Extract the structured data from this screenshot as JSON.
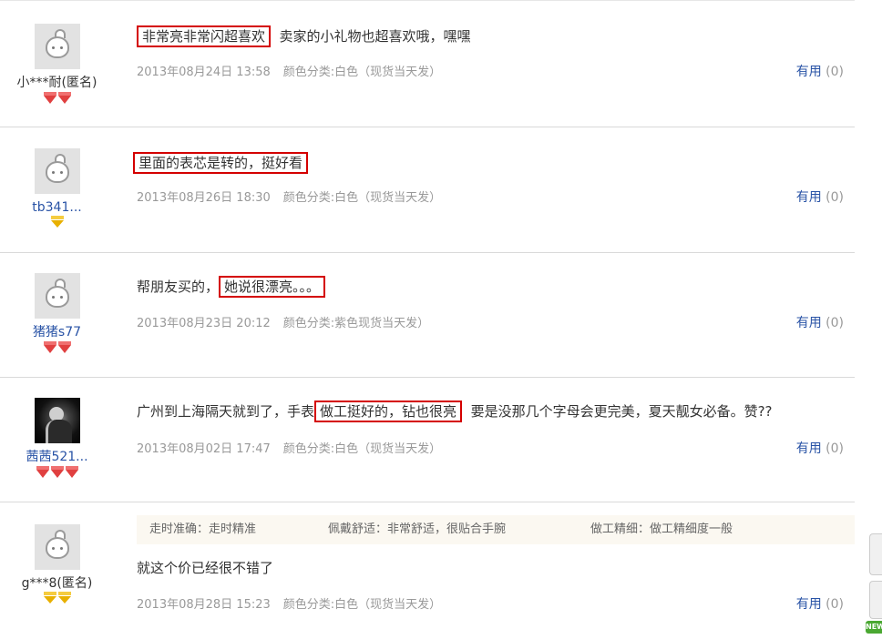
{
  "reviews": [
    {
      "user": {
        "name": "小***耐(匿名)",
        "link": false,
        "avatar": "default-avatar",
        "badge": {
          "color": "red",
          "count": 2
        }
      },
      "text_parts": [
        {
          "t": "非常亮非常闪超喜欢",
          "hl": true
        },
        {
          "t": "  卖家的小礼物也超喜欢哦，嘿嘿",
          "hl": false
        }
      ],
      "date": "2013年08月24日 13:58",
      "sku": "颜色分类:白色（现货当天发）",
      "useful_label": "有用",
      "useful_count": "(0)"
    },
    {
      "user": {
        "name": "tb341...",
        "link": true,
        "avatar": "default-avatar",
        "badge": {
          "color": "gold",
          "count": 1
        }
      },
      "text_parts": [
        {
          "t": "里面的表芯是转的，挺好看",
          "hl": true
        }
      ],
      "date": "2013年08月26日 18:30",
      "sku": "颜色分类:白色（现货当天发）",
      "useful_label": "有用",
      "useful_count": "(0)"
    },
    {
      "user": {
        "name": "猪猪s77",
        "link": true,
        "avatar": "default-avatar",
        "badge": {
          "color": "red",
          "count": 2
        }
      },
      "text_parts": [
        {
          "t": "帮朋友买的，",
          "hl": false
        },
        {
          "t": "她说很漂亮。。。",
          "hl": true
        }
      ],
      "date": "2013年08月23日 20:12",
      "sku": "颜色分类:紫色现货当天发）",
      "useful_label": "有用",
      "useful_count": "(0)"
    },
    {
      "user": {
        "name": "茜茜521...",
        "link": true,
        "avatar": "photo-avatar",
        "badge": {
          "color": "red",
          "count": 3
        }
      },
      "text_parts": [
        {
          "t": "广州到上海隔天就到了，手表",
          "hl": false
        },
        {
          "t": "做工挺好的，钻也很亮",
          "hl": true
        },
        {
          "t": "  要是没那几个字母会更完美，夏天靓女必备。赞??",
          "hl": false
        }
      ],
      "date": "2013年08月02日 17:47",
      "sku": "颜色分类:白色（现货当天发）",
      "useful_label": "有用",
      "useful_count": "(0)"
    },
    {
      "user": {
        "name": "g***8(匿名)",
        "link": false,
        "avatar": "default-avatar",
        "badge": {
          "color": "gold",
          "count": 2
        }
      },
      "attributes": [
        "走时准确：走时精准",
        "佩戴舒适：非常舒适，很贴合手腕",
        "做工精细：做工精细度一般"
      ],
      "text_parts": [
        {
          "t": "就这个价已经很不错了",
          "hl": false
        }
      ],
      "date": "2013年08月28日 15:23",
      "sku": "颜色分类:白色（现货当天发）",
      "useful_label": "有用",
      "useful_count": "(0)"
    }
  ],
  "side": {
    "new_badge": "NEW"
  },
  "colors": {
    "link": "#2953a6",
    "highlight_box": "#d40000",
    "muted": "#999999"
  }
}
